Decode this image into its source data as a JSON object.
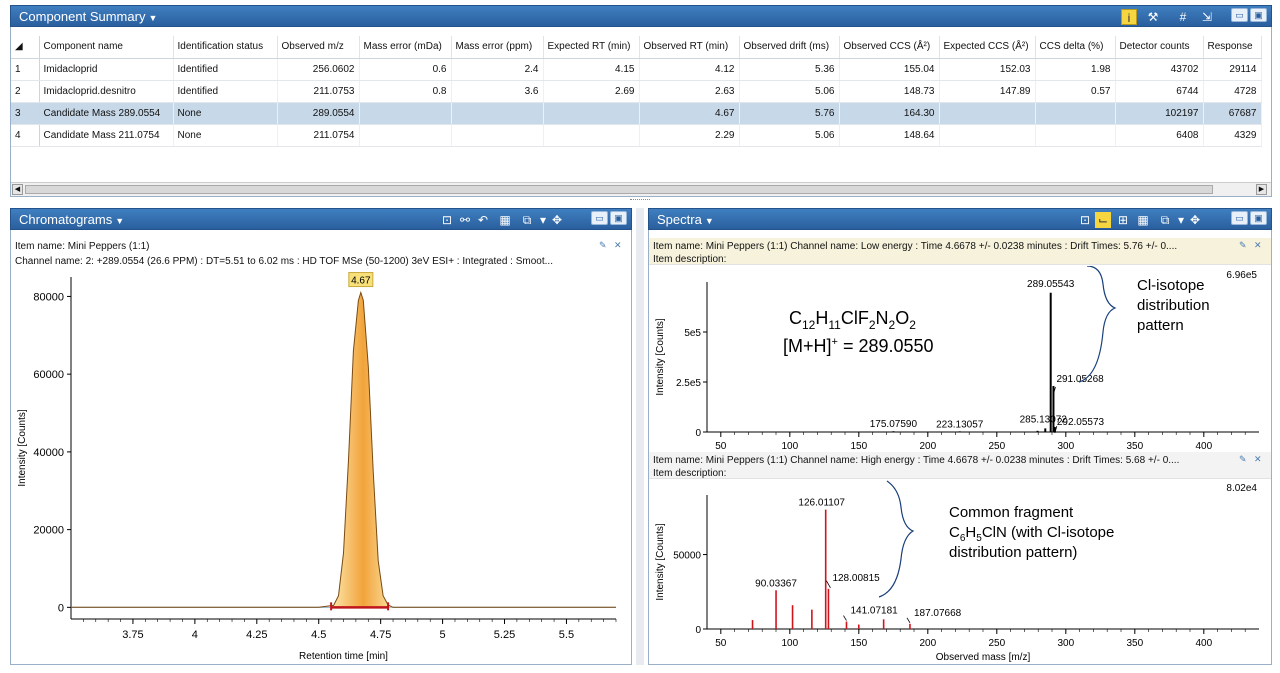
{
  "summary": {
    "title": "Component Summary",
    "columns": [
      "Component name",
      "Identification status",
      "Observed m/z",
      "Mass error (mDa)",
      "Mass error (ppm)",
      "Expected RT (min)",
      "Observed RT (min)",
      "Observed drift (ms)",
      "Observed CCS (Å²)",
      "Expected CCS (Å²)",
      "CCS delta (%)",
      "Detector counts",
      "Response"
    ],
    "rows": [
      [
        "1",
        "Imidacloprid",
        "Identified",
        "256.0602",
        "0.6",
        "2.4",
        "4.15",
        "4.12",
        "5.36",
        "155.04",
        "152.03",
        "1.98",
        "43702",
        "29114"
      ],
      [
        "2",
        "Imidacloprid.desnitro",
        "Identified",
        "211.0753",
        "0.8",
        "3.6",
        "2.69",
        "2.63",
        "5.06",
        "148.73",
        "147.89",
        "0.57",
        "6744",
        "4728"
      ],
      [
        "3",
        "Candidate Mass 289.0554",
        "None",
        "289.0554",
        "",
        "",
        "",
        "4.67",
        "5.76",
        "164.30",
        "",
        "",
        "102197",
        "67687"
      ],
      [
        "4",
        "Candidate Mass 211.0754",
        "None",
        "211.0754",
        "",
        "",
        "",
        "2.29",
        "5.06",
        "148.64",
        "",
        "",
        "6408",
        "4329"
      ]
    ],
    "selected_row": 2
  },
  "chromatogram": {
    "title": "Chromatograms",
    "item_name": "Item name: Mini Peppers (1:1)",
    "channel_name": "Channel name: 2: +289.0554 (26.6 PPM) : DT=5.51 to 6.02 ms : HD TOF MSe (50-1200) 3eV ESI+ : Integrated : Smoot...",
    "peak_label": "4.67",
    "ylabel": "Intensity [Counts]",
    "xlabel": "Retention time [min]",
    "peak_color": "#f2a33a"
  },
  "spectra": {
    "title": "Spectra",
    "low": {
      "item_line": "Item name: Mini Peppers (1:1)   Channel name: Low energy : Time 4.6678 +/- 0.0238 minutes : Drift Times: 5.76 +/- 0....",
      "description": "Item description:",
      "max_label": "6.96e5",
      "ylabel": "Intensity [Counts]",
      "formula": "C12H11ClF2N2O2",
      "formula_parts": {
        "c": "C",
        "c_n": "12",
        "h": "H",
        "h_n": "11",
        "clf": "ClF",
        "f_n": "2",
        "n": "N",
        "n_n": "2",
        "o": "O",
        "o_n": "2"
      },
      "adduct_line": "[M+H]+ = 289.0550",
      "adduct_parts": {
        "a": "[M+H]",
        "sup": "+",
        "b": " = 289.0550"
      },
      "annotation": [
        "Cl-isotope",
        "distribution",
        "pattern"
      ]
    },
    "high": {
      "item_line": "Item name: Mini Peppers (1:1) Channel name: High energy : Time 4.6678 +/- 0.0238 minutes : Drift Times: 5.68 +/- 0....",
      "description": "Item description:",
      "max_label": "8.02e4",
      "ylabel": "Intensity [Counts]",
      "xlabel": "Observed mass [m/z]",
      "annotation_parts": {
        "l1": "Common fragment",
        "l2a": "C",
        "l2b": "6",
        "l2c": "H",
        "l2d": "5",
        "l2e": "ClN (with   Cl-isotope",
        "l3": "distribution pattern)"
      }
    }
  },
  "chart_data": [
    {
      "type": "line",
      "name": "chromatogram",
      "xlabel": "Retention time [min]",
      "ylabel": "Intensity [Counts]",
      "xlim": [
        3.5,
        5.7
      ],
      "ylim": [
        -3000,
        85000
      ],
      "xticks": [
        3.75,
        4,
        4.25,
        4.5,
        4.75,
        5,
        5.25,
        5.5
      ],
      "xtick_labels": [
        "3.75",
        "4",
        "4.25",
        "4.5",
        "4.75",
        "5",
        "5.25",
        "5.5"
      ],
      "yticks": [
        0,
        20000,
        40000,
        60000,
        80000
      ],
      "ytick_labels": [
        "0",
        "20000",
        "40000",
        "60000",
        "80000"
      ],
      "x": [
        3.5,
        4.5,
        4.56,
        4.58,
        4.6,
        4.62,
        4.64,
        4.66,
        4.67,
        4.68,
        4.7,
        4.72,
        4.74,
        4.76,
        4.78,
        4.8,
        5.7
      ],
      "y": [
        0,
        0,
        500,
        3000,
        14000,
        38000,
        66000,
        79000,
        81000,
        79000,
        62000,
        35000,
        12000,
        3000,
        600,
        0,
        0
      ],
      "peak_label": "4.67"
    },
    {
      "type": "bar",
      "name": "low-energy-spectrum",
      "ylabel": "Intensity [Counts]",
      "xlim": [
        40,
        440
      ],
      "ylim": [
        0,
        750000
      ],
      "xticks": [
        50,
        100,
        150,
        200,
        250,
        300,
        350,
        400
      ],
      "xtick_labels": [
        "50",
        "100",
        "150",
        "200",
        "250",
        "300",
        "350",
        "400"
      ],
      "yticks": [
        0,
        250000,
        500000
      ],
      "ytick_labels": [
        "0",
        "2.5e5",
        "5e5"
      ],
      "peaks": [
        {
          "mz": 175.0759,
          "intensity": 4000,
          "label": "175.07590"
        },
        {
          "mz": 223.13057,
          "intensity": 3500,
          "label": "223.13057"
        },
        {
          "mz": 279.5,
          "intensity": 6000,
          "label": ""
        },
        {
          "mz": 285.13072,
          "intensity": 18000,
          "label": "285.13072"
        },
        {
          "mz": 289.05543,
          "intensity": 696000,
          "label": "289.05543"
        },
        {
          "mz": 291.05268,
          "intensity": 230000,
          "label": "291.05268"
        },
        {
          "mz": 292.05573,
          "intensity": 25000,
          "label": "292.05573"
        }
      ]
    },
    {
      "type": "bar",
      "name": "high-energy-spectrum",
      "ylabel": "Intensity [Counts]",
      "xlabel": "Observed mass [m/z]",
      "xlim": [
        40,
        440
      ],
      "ylim": [
        0,
        90000
      ],
      "xticks": [
        50,
        100,
        150,
        200,
        250,
        300,
        350,
        400
      ],
      "xtick_labels": [
        "50",
        "100",
        "150",
        "200",
        "250",
        "300",
        "350",
        "400"
      ],
      "yticks": [
        0,
        50000
      ],
      "ytick_labels": [
        "0",
        "50000"
      ],
      "peaks": [
        {
          "mz": 73.0,
          "intensity": 6000,
          "label": ""
        },
        {
          "mz": 90.03367,
          "intensity": 26000,
          "label": "90.03367"
        },
        {
          "mz": 102.0,
          "intensity": 16000,
          "label": ""
        },
        {
          "mz": 116.0,
          "intensity": 13000,
          "label": ""
        },
        {
          "mz": 126.01107,
          "intensity": 80200,
          "label": "126.01107"
        },
        {
          "mz": 128.00815,
          "intensity": 27000,
          "label": "128.00815"
        },
        {
          "mz": 141.07181,
          "intensity": 5000,
          "label": "141.07181"
        },
        {
          "mz": 150.0,
          "intensity": 3000,
          "label": ""
        },
        {
          "mz": 168.0,
          "intensity": 6500,
          "label": ""
        },
        {
          "mz": 187.07668,
          "intensity": 3500,
          "label": "187.07668"
        }
      ]
    }
  ]
}
